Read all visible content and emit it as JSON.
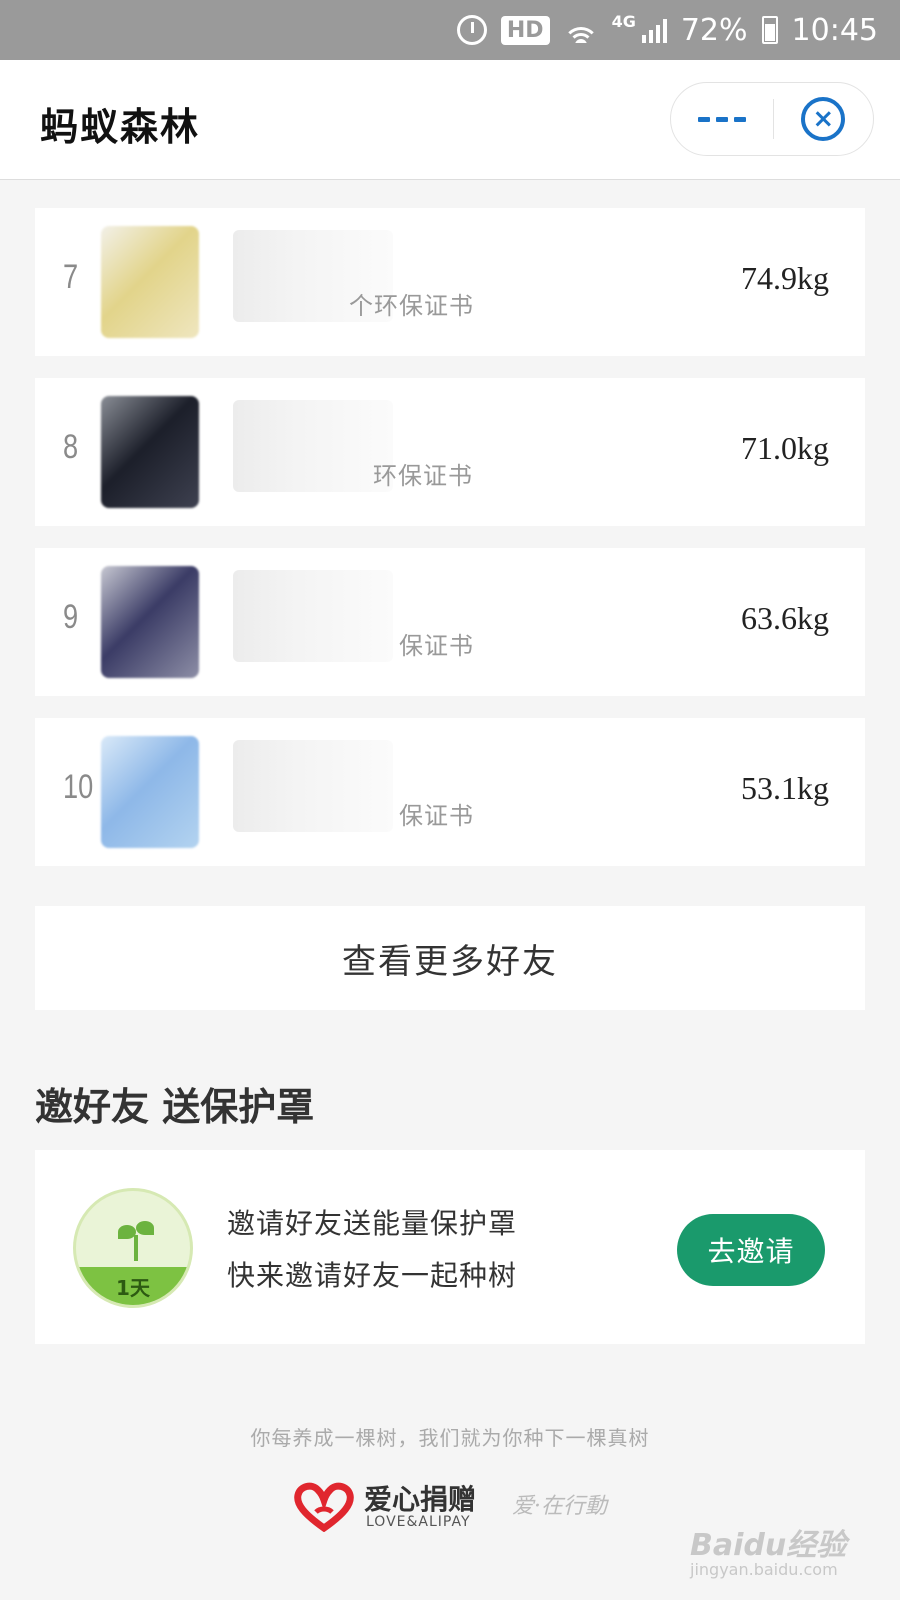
{
  "status_bar": {
    "hd": "HD",
    "network": "4G",
    "battery": "72%",
    "time": "10:45"
  },
  "header": {
    "title": "蚂蚁森林",
    "more_icon": "more-icon",
    "close_icon": "close-icon"
  },
  "ranking": [
    {
      "rank": "7",
      "cert": "个环保证书",
      "weight": "74.9kg",
      "avatar_colors": [
        "#f2f0e8",
        "#e2d48a",
        "#efe6bf"
      ]
    },
    {
      "rank": "8",
      "cert": "环保证书",
      "weight": "71.0kg",
      "avatar_colors": [
        "#8a8e96",
        "#1c1f2a",
        "#3e4150"
      ]
    },
    {
      "rank": "9",
      "cert": "保证书",
      "weight": "63.6kg",
      "avatar_colors": [
        "#c7c8d2",
        "#3b3c66",
        "#8d8ea6"
      ]
    },
    {
      "rank": "10",
      "cert": "保证书",
      "weight": "53.1kg",
      "avatar_colors": [
        "#d9e9f8",
        "#8eb8e8",
        "#b3d3f0"
      ]
    }
  ],
  "more_friends_label": "查看更多好友",
  "invite_section": {
    "title": "邀好友 送保护罩",
    "badge_text": "1天",
    "line1": "邀请好友送能量保护罩",
    "line2": "快来邀请好友一起种树",
    "button_label": "去邀请"
  },
  "footer": {
    "slogan": "你每养成一棵树，我们就为你种下一棵真树",
    "logo_cn": "爱心捐赠",
    "logo_en": "LOVE&ALIPAY",
    "logo_script": "爱·在行動"
  },
  "watermark": {
    "brand": "Baidu经验",
    "url": "jingyan.baidu.com"
  },
  "colors": {
    "accent_blue": "#1a73c8",
    "button_green": "#1a9a6c",
    "heart_red": "#e0262e"
  }
}
